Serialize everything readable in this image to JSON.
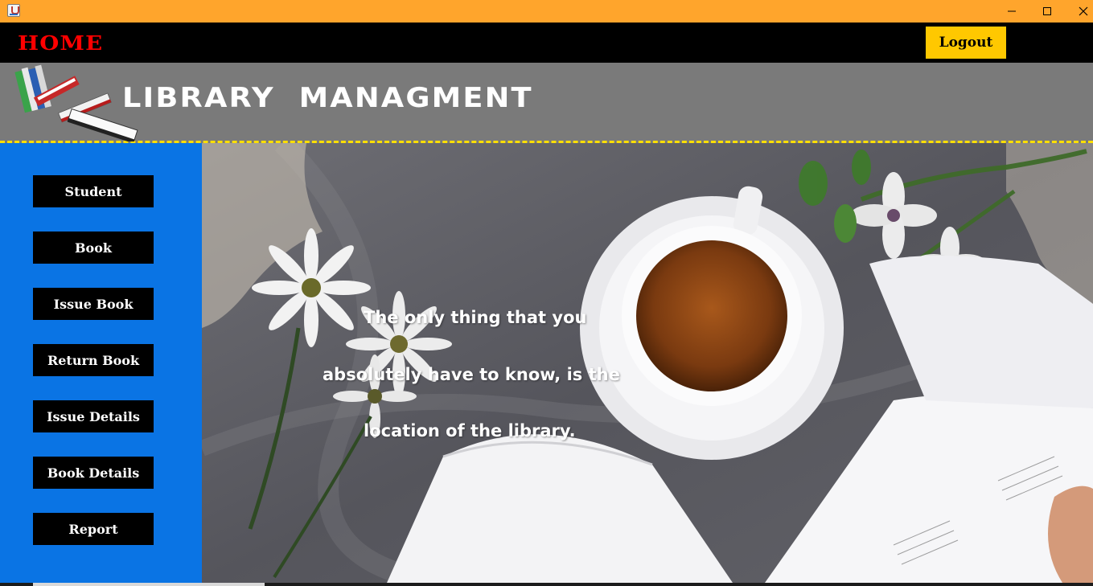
{
  "window": {
    "icon": "java-cup-icon",
    "controls": [
      "minimize-icon",
      "maximize-icon",
      "close-icon"
    ]
  },
  "topbar": {
    "home_label": "HOME",
    "logout_label": "Logout",
    "home_color": "#ff0000",
    "logout_bg": "#ffc800"
  },
  "header": {
    "title": "LIBRARY  MANAGMENT",
    "logo": "books-stack-logo",
    "bg": "#7a7a7a",
    "border_color": "#ffdf00"
  },
  "sidebar": {
    "bg": "#0a74e4",
    "items": [
      {
        "label": "Student"
      },
      {
        "label": "Book"
      },
      {
        "label": "Issue Book"
      },
      {
        "label": "Return Book"
      },
      {
        "label": "Issue Details"
      },
      {
        "label": "Book Details"
      },
      {
        "label": "Report"
      }
    ]
  },
  "main": {
    "quote": [
      "The only thing that you",
      "absolutely have to know, is the",
      "location of the library."
    ]
  }
}
